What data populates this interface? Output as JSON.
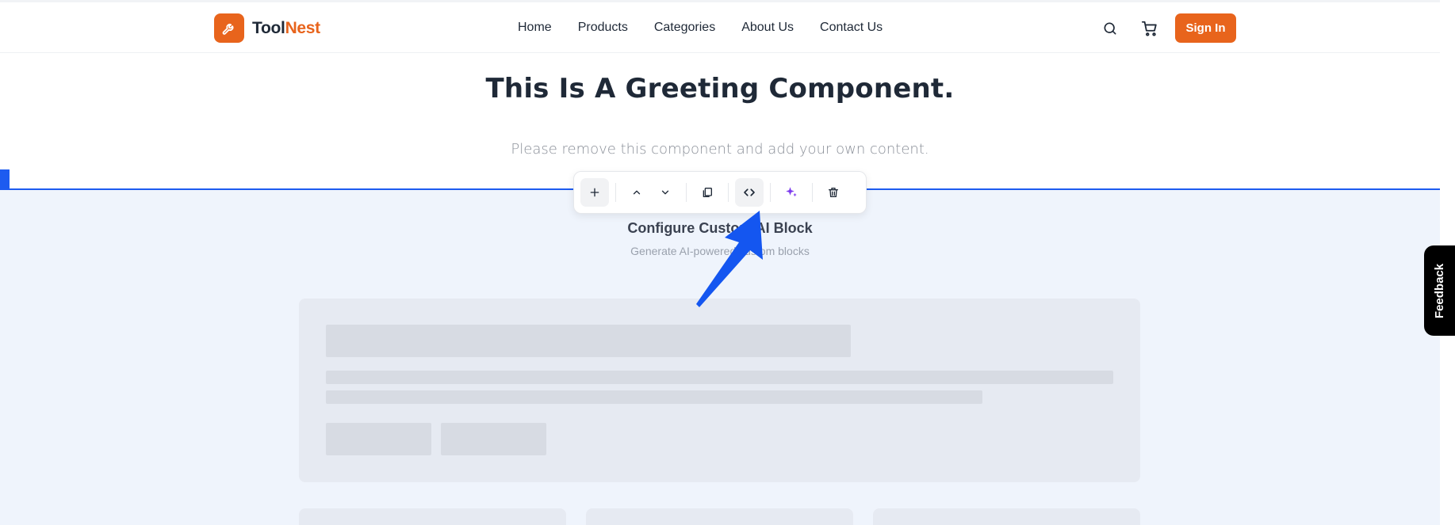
{
  "brand": {
    "name_part1": "Tool",
    "name_part2": "Nest",
    "accent": "#e8641c"
  },
  "nav": {
    "links": [
      "Home",
      "Products",
      "Categories",
      "About Us",
      "Contact Us"
    ],
    "search_icon": "search-icon",
    "cart_icon": "cart-icon",
    "signin_label": "Sign In"
  },
  "greeting": {
    "title": "This Is A Greeting Component.",
    "subtitle": "Please remove this component and add your own content."
  },
  "toolbar": {
    "icons": [
      "plus-icon",
      "chevron-up-icon",
      "chevron-down-icon",
      "copy-icon",
      "code-icon",
      "sparkles-icon",
      "trash-icon"
    ],
    "active": "code-icon"
  },
  "ai_block": {
    "title": "Configure Custom AI Block",
    "subtitle": "Generate AI-powered custom blocks"
  },
  "feedback": {
    "label": "Feedback"
  },
  "colors": {
    "selection": "#1d5bf0",
    "section_bg": "#eff4fc",
    "skeleton": "#d7dbe3",
    "ai_purple": "#7c3aed"
  }
}
